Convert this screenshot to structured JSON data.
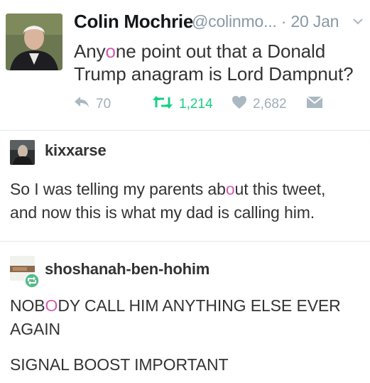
{
  "tweet": {
    "author_name": "Colin Mochrie",
    "handle_time": "@colinmo... · 20 Jan",
    "text_part1": "Any",
    "text_highlight": "o",
    "text_part2": "ne point out that a Donald",
    "text_line2": "Trump anagram is Lord Dampnut?",
    "replies": "70",
    "retweets": "1,214",
    "likes": "2,682",
    "icons": [
      "reply-icon",
      "retweet-icon",
      "heart-icon",
      "envelope-icon",
      "chevron-down-icon"
    ]
  },
  "post1": {
    "username": "kixxarse",
    "text_part1": "So I was telling my parents ab",
    "text_highlight": "o",
    "text_part2": "ut this tweet,",
    "text_line2": "and now this is what my dad is calling him."
  },
  "post2": {
    "username": "shoshanah-ben-hohim",
    "text_part1": "NOB",
    "text_highlight": "O",
    "text_part2": "DY CALL HIM ANYTHING ELSE EVER",
    "text_line2": "AGAIN",
    "text_line3": "SIGNAL BOOST IMPORTANT",
    "accent": "#56bc8a"
  }
}
